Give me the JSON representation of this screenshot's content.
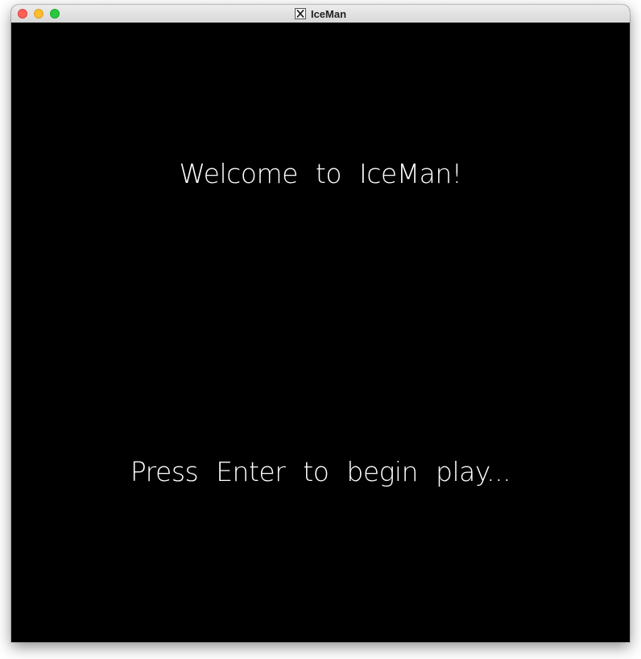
{
  "window": {
    "title": "IceMan",
    "icon": "x11-icon"
  },
  "screen": {
    "welcome_text": "Welcome to IceMan!",
    "prompt_text": "Press Enter to begin play..."
  },
  "colors": {
    "background": "#000000",
    "text": "#ffffff"
  }
}
